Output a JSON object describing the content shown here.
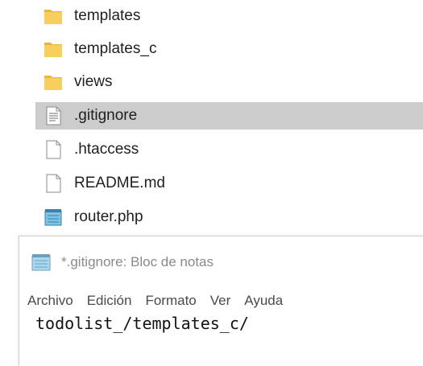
{
  "explorer": {
    "items": [
      {
        "name": "templates",
        "icon": "folder-icon",
        "selected": false
      },
      {
        "name": "templates_c",
        "icon": "folder-icon",
        "selected": false
      },
      {
        "name": "views",
        "icon": "folder-icon",
        "selected": false
      },
      {
        "name": ".gitignore",
        "icon": "text-document-icon",
        "selected": true
      },
      {
        "name": ".htaccess",
        "icon": "blank-file-icon",
        "selected": false
      },
      {
        "name": "README.md",
        "icon": "blank-file-icon",
        "selected": false
      },
      {
        "name": "router.php",
        "icon": "notepad-file-icon",
        "selected": false
      }
    ]
  },
  "notepad": {
    "title": "*.gitignore: Bloc de notas",
    "menu": [
      "Archivo",
      "Edición",
      "Formato",
      "Ver",
      "Ayuda"
    ],
    "content": "todolist_/templates_c/"
  },
  "colors": {
    "selected_row": "#cccccc",
    "folder": "#f6c94e",
    "title_text": "#8a8a8a"
  }
}
